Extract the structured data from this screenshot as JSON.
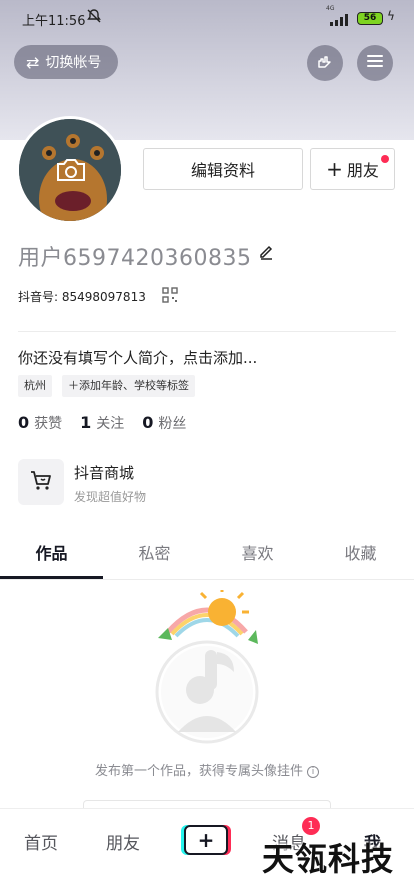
{
  "status_bar": {
    "time": "上午11:56",
    "network": "4G",
    "battery": "56"
  },
  "header": {
    "switch_account": "切换帐号"
  },
  "profile": {
    "edit_profile": "编辑资料",
    "add_friend": "朋友",
    "username": "用户6597420360835",
    "douyin_id": "抖音号: 85498097813",
    "bio": "你还没有填写个人简介，点击添加...",
    "tags": [
      "杭州",
      "添加年龄、学校等标签"
    ],
    "stats": [
      {
        "value": "0",
        "label": "获赞"
      },
      {
        "value": "1",
        "label": "关注"
      },
      {
        "value": "0",
        "label": "粉丝"
      }
    ]
  },
  "shop": {
    "title": "抖音商城",
    "subtitle": "发现超值好物"
  },
  "tabs": [
    {
      "label": "作品",
      "active": true
    },
    {
      "label": "私密",
      "active": false
    },
    {
      "label": "喜欢",
      "active": false
    },
    {
      "label": "收藏",
      "active": false
    }
  ],
  "empty_state": {
    "text": "发布第一个作品，获得专属头像挂件"
  },
  "bottom_nav": {
    "home": "首页",
    "friends": "朋友",
    "plus": "+",
    "messages": "消息",
    "message_badge": "1",
    "me": "我"
  },
  "watermark": "天瓴科技",
  "colors": {
    "accent": "#fe2c55",
    "cyan": "#25f4ee",
    "text": "#161823"
  }
}
